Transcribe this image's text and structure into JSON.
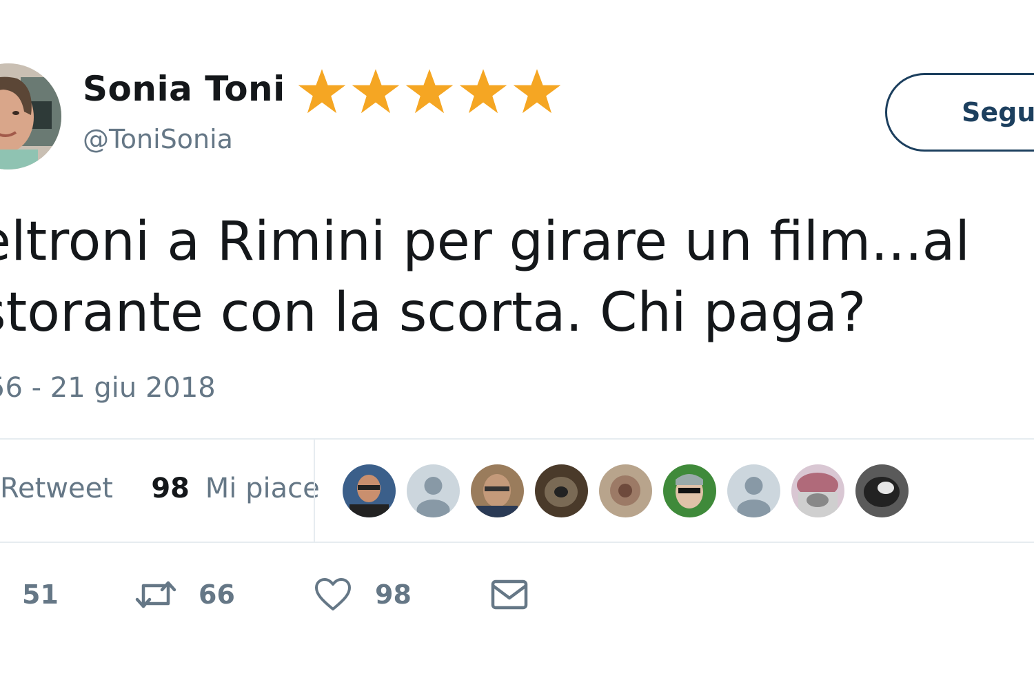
{
  "tweet": {
    "display_name": "Sonia Toni",
    "handle": "@ToniSonia",
    "name_decoration": "five-star-emoji",
    "star_count": 5,
    "star_color": "#f5a623",
    "follow_label": "Segui",
    "text_lines": [
      "eltroni a Rimini per girare un film...al",
      "storante con la scorta. Chi paga?"
    ],
    "timestamp": "56 - 21 giu 2018"
  },
  "stats": {
    "retweet_label": "Retweet",
    "likes_count": "98",
    "likes_label": "Mi piace"
  },
  "likers": {
    "count": 9
  },
  "actions": {
    "reply_icon": "reply-icon",
    "reply_count": "51",
    "retweet_icon": "retweet-icon",
    "retweet_count": "66",
    "like_icon": "heart-icon",
    "like_count": "98",
    "dm_icon": "envelope-icon"
  },
  "colors": {
    "text_primary": "#14171a",
    "text_secondary": "#657786",
    "follow_border": "#1c3f5e",
    "divider": "#e6ecf0"
  }
}
